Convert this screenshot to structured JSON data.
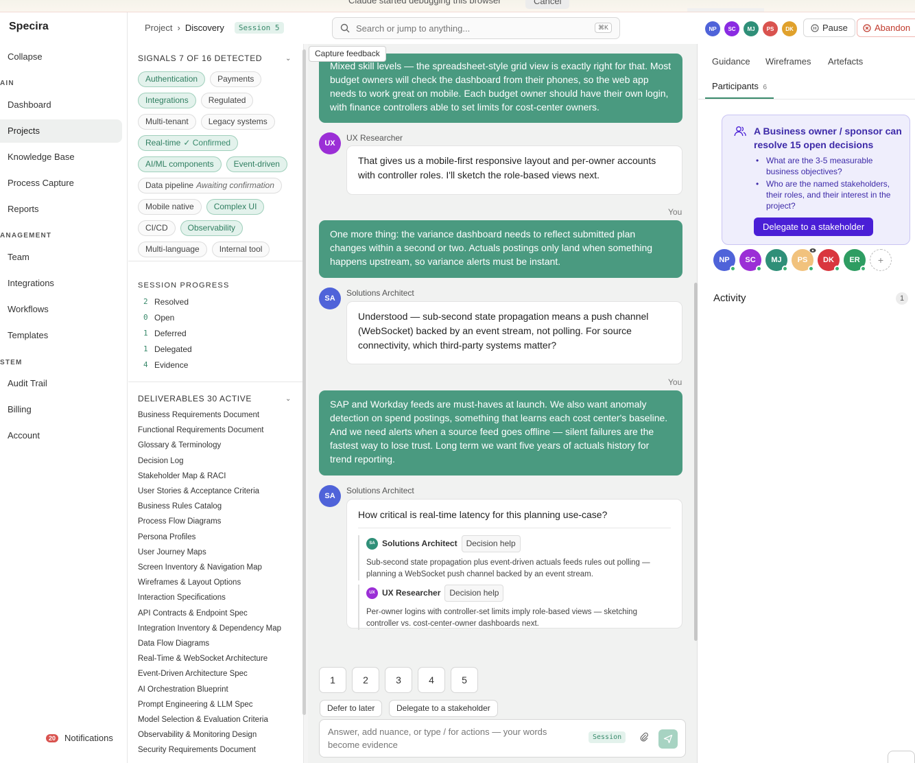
{
  "banner": {
    "message": "Claude started debugging this browser",
    "cancel": "Cancel"
  },
  "brand": "Specira",
  "sidebar": {
    "collapse": "Collapse",
    "sections": {
      "main": "AIN",
      "management": "ANAGEMENT",
      "system": "STEM"
    },
    "items": {
      "dashboard": "Dashboard",
      "projects": "Projects",
      "knowledge": "Knowledge Base",
      "process": "Process Capture",
      "reports": "Reports",
      "team": "Team",
      "integrations": "Integrations",
      "workflows": "Workflows",
      "templates": "Templates",
      "audit": "Audit Trail",
      "billing": "Billing",
      "account": "Account"
    },
    "notifications": {
      "label": "Notifications",
      "count": "20"
    }
  },
  "header": {
    "breadcrumb_root": "Project",
    "breadcrumb_sep": "›",
    "breadcrumb_current": "Discovery",
    "session": "Session 5",
    "search_placeholder": "Search or jump to anything...",
    "search_shortcut": "⌘K",
    "avatars": [
      {
        "initials": "NP",
        "color": "#4f63d9"
      },
      {
        "initials": "SC",
        "color": "#8a2be2"
      },
      {
        "initials": "MJ",
        "color": "#2f8f78"
      },
      {
        "initials": "PS",
        "color": "#d9534f"
      },
      {
        "initials": "DK",
        "color": "#e0a12c"
      }
    ],
    "pause": "Pause",
    "abandon": "Abandon"
  },
  "signals": {
    "title": "SIGNALS 7 OF 16 DETECTED",
    "chips": [
      {
        "label": "Authentication",
        "on": true
      },
      {
        "label": "Payments",
        "on": false
      },
      {
        "label": "Integrations",
        "on": true
      },
      {
        "label": "Regulated",
        "on": false
      },
      {
        "label": "Multi-tenant",
        "on": false
      },
      {
        "label": "Legacy systems",
        "on": false
      },
      {
        "label": "Real-time",
        "on": true,
        "sub": "✓ Confirmed"
      },
      {
        "label": "AI/ML components",
        "on": true
      },
      {
        "label": "Event-driven",
        "on": true
      },
      {
        "label": "Data pipeline",
        "on": false,
        "pend": "Awaiting confirmation"
      },
      {
        "label": "Mobile native",
        "on": false
      },
      {
        "label": "Complex UI",
        "on": true
      },
      {
        "label": "CI/CD",
        "on": false
      },
      {
        "label": "Observability",
        "on": true
      },
      {
        "label": "Multi-language",
        "on": false
      },
      {
        "label": "Internal tool",
        "on": false
      }
    ]
  },
  "progress": {
    "title": "SESSION PROGRESS",
    "rows": [
      {
        "n": "2",
        "label": "Resolved"
      },
      {
        "n": "0",
        "label": "Open"
      },
      {
        "n": "1",
        "label": "Deferred"
      },
      {
        "n": "1",
        "label": "Delegated"
      },
      {
        "n": "4",
        "label": "Evidence"
      }
    ]
  },
  "deliverables": {
    "title": "DELIVERABLES 30 ACTIVE",
    "items": [
      "Business Requirements Document",
      "Functional Requirements Document",
      "Glossary & Terminology",
      "Decision Log",
      "Stakeholder Map & RACI",
      "User Stories & Acceptance Criteria",
      "Business Rules Catalog",
      "Process Flow Diagrams",
      "Persona Profiles",
      "User Journey Maps",
      "Screen Inventory & Navigation Map",
      "Wireframes & Layout Options",
      "Interaction Specifications",
      "API Contracts & Endpoint Spec",
      "Integration Inventory & Dependency Map",
      "Data Flow Diagrams",
      "Real-Time & WebSocket Architecture",
      "Event-Driven Architecture Spec",
      "AI Orchestration Blueprint",
      "Prompt Engineering & LLM Spec",
      "Model Selection & Evaluation Criteria",
      "Observability & Monitoring Design",
      "Security Requirements Document"
    ]
  },
  "chat": {
    "capture_feedback": "Capture feedback",
    "you": "You",
    "msg1": "Mixed skill levels — the spreadsheet-style grid view is exactly right for that. Most budget owners will check the dashboard from their phones, so the web app needs to work great on mobile. Each budget owner should have their own login, with finance controllers able to set limits for cost-center owners.",
    "ux_name": "UX Researcher",
    "ux_initials": "UX",
    "msg2": "That gives us a mobile-first responsive layout and per-owner accounts with controller roles. I'll sketch the role-based views next.",
    "msg3": "One more thing: the variance dashboard needs to reflect submitted plan changes within a second or two. Actuals postings only land when something happens upstream, so variance alerts must be instant.",
    "sa_name": "Solutions Architect",
    "sa_initials": "SA",
    "msg4": "Understood — sub-second state propagation means a push channel (WebSocket) backed by an event stream, not polling. For source connectivity, which third-party systems matter?",
    "msg5": "SAP and Workday feeds are must-haves at launch. We also want anomaly detection on spend postings, something that learns each cost center's baseline. And we need alerts when a source feed goes offline — silent failures are the fastest way to lose trust. Long term we want five years of actuals history for trend reporting.",
    "msg6": "How critical is real-time latency for this planning use-case?",
    "help_tag": "Decision help",
    "help1": "Sub-second state propagation plus event-driven actuals feeds rules out polling — planning a WebSocket push channel backed by an event stream.",
    "help2": "Per-owner logins with controller-set limits imply role-based views — sketching controller vs. cost-center-owner dashboards next.",
    "options": [
      "1",
      "2",
      "3",
      "4",
      "5"
    ],
    "defer": "Defer to later",
    "delegate": "Delegate to a stakeholder",
    "composer_placeholder": "Answer, add nuance, or type / for actions — your words become evidence",
    "composer_session": "Session"
  },
  "right": {
    "tabs": [
      "Guidance",
      "Wireframes",
      "Artefacts"
    ],
    "participants_tab": "Participants",
    "participants_count": "6",
    "card_title": "A Business owner / sponsor can resolve 15 open decisions",
    "card_items": [
      "What are the 3-5 measurable business objectives?",
      "Who are the named stakeholders, their roles, and their interest in the project?"
    ],
    "card_button": "Delegate to a stakeholder",
    "participants": [
      {
        "initials": "NP",
        "color": "#4f63d9"
      },
      {
        "initials": "SC",
        "color": "#9b2fd6"
      },
      {
        "initials": "MJ",
        "color": "#2f8f78"
      },
      {
        "initials": "PS",
        "color": "#f1c27d"
      },
      {
        "initials": "DK",
        "color": "#d9363e"
      },
      {
        "initials": "ER",
        "color": "#2e9d62"
      }
    ],
    "add": "+",
    "activity": "Activity",
    "activity_count": "1"
  },
  "colors": {
    "accent": "#4a9a80",
    "brand_purple": "#4a1fd6",
    "danger": "#c0392b"
  }
}
